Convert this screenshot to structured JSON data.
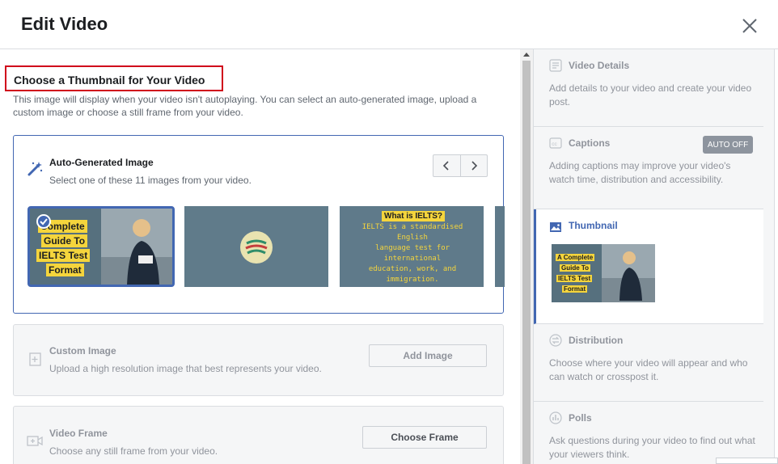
{
  "dialog": {
    "title": "Edit Video"
  },
  "thumbnail_chooser": {
    "title": "Choose a Thumbnail for Your Video",
    "description": "This image will display when your video isn't autoplaying. You can select an auto-generated image, upload a custom image or choose a still frame from your video."
  },
  "auto_generated": {
    "title": "Auto-Generated Image",
    "subtitle": "Select one of these 11 images from your video.",
    "thumbs": [
      {
        "lines": [
          "Complete",
          "Guide To",
          "IELTS Test",
          "Format"
        ]
      },
      {
        "lines": []
      },
      {
        "lines": [
          "What is IELTS?",
          "IELTS is a standardised English",
          "language test for international",
          "education, work, and immigration."
        ]
      },
      {
        "lines": []
      }
    ]
  },
  "custom_image": {
    "title": "Custom Image",
    "subtitle": "Upload a high resolution image that best represents your video.",
    "button": "Add Image"
  },
  "video_frame": {
    "title": "Video Frame",
    "subtitle": "Choose any still frame from your video.",
    "button": "Choose Frame"
  },
  "sidebar": {
    "sections": [
      {
        "title": "Video Details",
        "desc": "Add details to your video and create your video post."
      },
      {
        "title": "Captions",
        "desc": "Adding captions may improve your video's watch time, distribution and accessibility.",
        "badge": "AUTO OFF"
      },
      {
        "title": "Thumbnail",
        "thumb_lines": [
          "A Complete",
          "Guide To",
          "IELTS Test",
          "Format"
        ]
      },
      {
        "title": "Distribution",
        "desc": "Choose where your video will appear and who can watch or crosspost it."
      },
      {
        "title": "Polls",
        "desc": "Ask questions during your video to find out what your viewers think."
      }
    ]
  },
  "colors": {
    "accent": "#4267b2",
    "highlight_border": "#d0021b",
    "thumb_text_bg": "#f5d53c"
  }
}
